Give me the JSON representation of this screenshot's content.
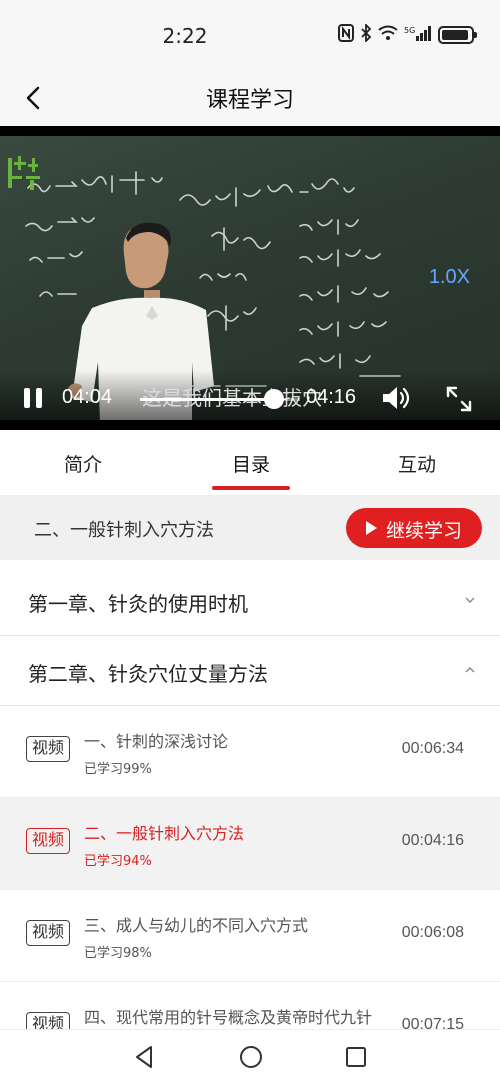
{
  "status_bar": {
    "time": "2:22",
    "network": "5G"
  },
  "nav": {
    "title": "课程学习",
    "back_icon": "chevron-left-icon"
  },
  "video": {
    "speed": "1.0X",
    "current_time": "04:04",
    "total_time": "04:16",
    "subtitle": "这是我们基本上拔穴",
    "progress_fraction": 0.84
  },
  "tabs": [
    {
      "label": "简介",
      "active": false
    },
    {
      "label": "目录",
      "active": true
    },
    {
      "label": "互动",
      "active": false
    }
  ],
  "continue": {
    "current_lesson": "二、一般针刺入穴方法",
    "button_label": "继续学习"
  },
  "chapters": [
    {
      "title": "第一章、针灸的使用时机",
      "expanded": false
    },
    {
      "title": "第二章、针灸穴位丈量方法",
      "expanded": true
    }
  ],
  "lessons": [
    {
      "tag": "视频",
      "title": "一、针刺的深浅讨论",
      "progress": "已学习99%",
      "duration": "00:06:34",
      "current": false
    },
    {
      "tag": "视频",
      "title": "二、一般针刺入穴方法",
      "progress": "已学习94%",
      "duration": "00:04:16",
      "current": true
    },
    {
      "tag": "视频",
      "title": "三、成人与幼儿的不同入穴方式",
      "progress": "已学习98%",
      "duration": "00:06:08",
      "current": false
    },
    {
      "tag": "视频",
      "title": "四、现代常用的针号概念及黄帝时代九针",
      "progress": "",
      "duration": "00:07:15",
      "current": false
    }
  ],
  "colors": {
    "accent": "#e02020",
    "current_text": "#d92121",
    "speed_label": "#63a9ff"
  }
}
